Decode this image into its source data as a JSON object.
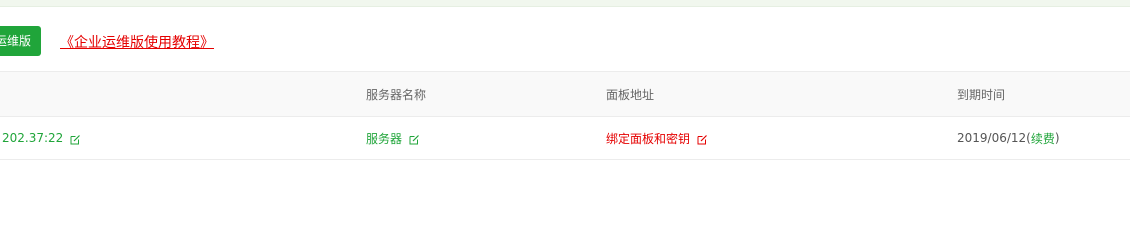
{
  "toolbar": {
    "button_label": "运维版",
    "tutorial_link": "《企业运维版使用教程》"
  },
  "table": {
    "headers": [
      "",
      "服务器名称",
      "面板地址",
      "到期时间"
    ],
    "rows": [
      {
        "ip": "202.37:22",
        "server_name": "服务器",
        "panel_address": "绑定面板和密钥",
        "expiry_date": "2019/06/12(",
        "renew_label": "续费",
        "expiry_close": ")"
      }
    ]
  },
  "colors": {
    "accent": "#20a53a",
    "link": "#e50000"
  },
  "icons": {
    "edit": "edit-icon"
  }
}
